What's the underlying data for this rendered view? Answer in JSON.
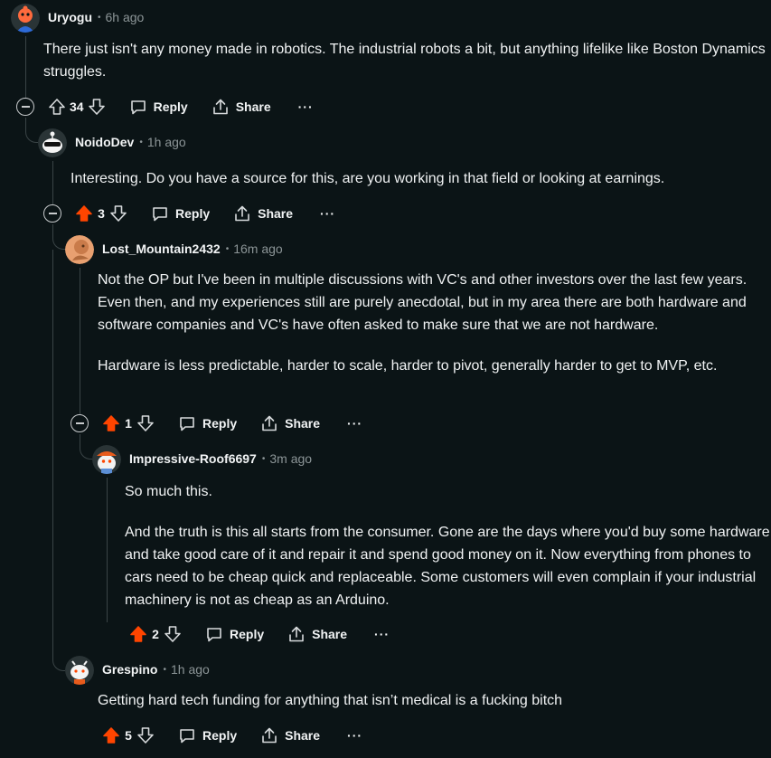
{
  "comments": [
    {
      "author": "Uryogu",
      "time": "6h ago",
      "body": [
        "There just isn't any money made in robotics. The industrial robots a bit, but anything lifelike like Boston Dynamics struggles."
      ],
      "score": "34",
      "upvoted": false,
      "reply": "Reply",
      "share": "Share",
      "more": "···"
    },
    {
      "author": "NoidoDev",
      "time": "1h ago",
      "body": [
        "Interesting. Do you have a source for this, are you working in that field or looking at earnings."
      ],
      "score": "3",
      "upvoted": true,
      "reply": "Reply",
      "share": "Share",
      "more": "···"
    },
    {
      "author": "Lost_Mountain2432",
      "time": "16m ago",
      "body": [
        "Not the OP but I've been in multiple discussions with VC's and other investors over the last few years. Even then, and my experiences still are purely anecdotal, but in my area there are both hardware and software companies and VC's have often asked to make sure that we are not hardware.",
        "Hardware is less predictable, harder to scale, harder to pivot, generally harder to get to MVP, etc."
      ],
      "score": "1",
      "upvoted": true,
      "reply": "Reply",
      "share": "Share",
      "more": "···"
    },
    {
      "author": "Impressive-Roof6697",
      "time": "3m ago",
      "body": [
        "So much this.",
        "And the truth is this all starts from the consumer. Gone are the days where you'd buy some hardware and take good care of it and repair it and spend good money on it. Now everything from phones to cars need to be cheap quick and replaceable. Some customers will even complain if your industrial machinery is not as cheap as an Arduino."
      ],
      "score": "2",
      "upvoted": true,
      "reply": "Reply",
      "share": "Share",
      "more": "···"
    },
    {
      "author": "Grespino",
      "time": "1h ago",
      "body": [
        "Getting hard tech funding for anything that isn’t medical is a fucking bitch"
      ],
      "score": "5",
      "upvoted": true,
      "reply": "Reply",
      "share": "Share",
      "more": "···"
    }
  ],
  "separator": "•",
  "colors": {
    "background": "#0b1416",
    "upvote": "#ff4500",
    "text": "#f0f2f3",
    "meta": "#8c9597",
    "thread": "#3a4446"
  },
  "icons": {
    "upvote": "arrow-up-icon",
    "downvote": "arrow-down-icon",
    "reply": "chat-bubble-icon",
    "share": "share-icon",
    "collapse": "minus-circle-icon"
  }
}
